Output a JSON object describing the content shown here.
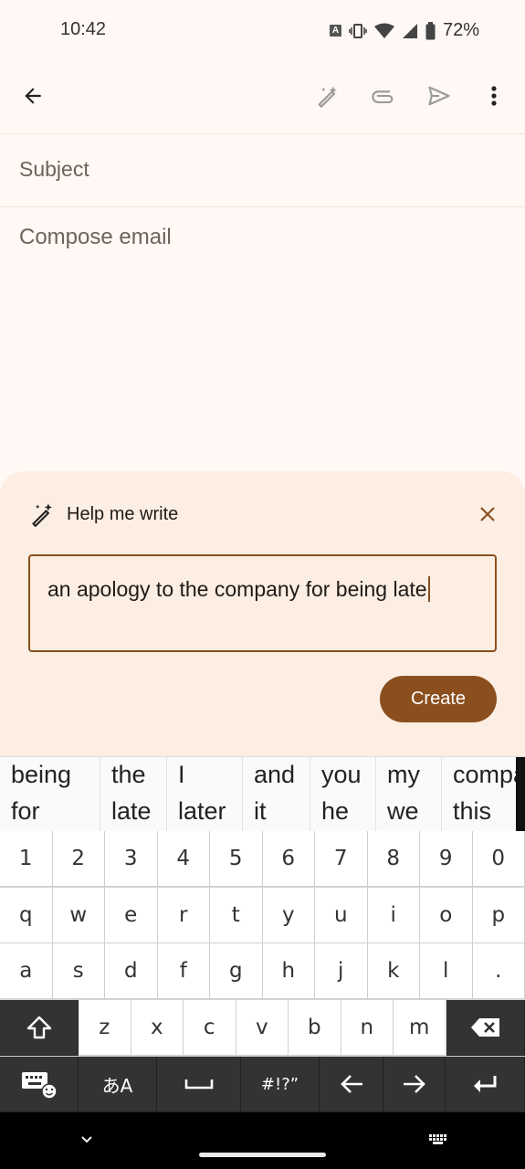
{
  "status_bar": {
    "time": "10:42",
    "battery": "72%",
    "input_badge": "A"
  },
  "compose": {
    "subject_placeholder": "Subject",
    "body_placeholder": "Compose email"
  },
  "help_me_write": {
    "title": "Help me write",
    "prompt_text": "an apology to the company for being late",
    "create_label": "Create"
  },
  "suggestions": [
    {
      "top": "being",
      "bottom": "for"
    },
    {
      "top": "the",
      "bottom": "late"
    },
    {
      "top": "I",
      "bottom": "later"
    },
    {
      "top": "and",
      "bottom": "it"
    },
    {
      "top": "you",
      "bottom": "he"
    },
    {
      "top": "my",
      "bottom": "we"
    },
    {
      "top": "compa",
      "bottom": "this"
    }
  ],
  "keyboard": {
    "row_numbers": [
      "1",
      "2",
      "3",
      "4",
      "5",
      "6",
      "7",
      "8",
      "9",
      "0"
    ],
    "row_q": [
      "q",
      "w",
      "e",
      "r",
      "t",
      "y",
      "u",
      "i",
      "o",
      "p"
    ],
    "row_a": [
      "a",
      "s",
      "d",
      "f",
      "g",
      "h",
      "j",
      "k",
      "l",
      "."
    ],
    "row_z": [
      "z",
      "x",
      "c",
      "v",
      "b",
      "n",
      "m"
    ],
    "lang_label": "あA",
    "symbols_label": "#!?”"
  },
  "colors": {
    "accent": "#8b4f1e",
    "panel": "#fdeee3",
    "background": "#fff8f4"
  }
}
